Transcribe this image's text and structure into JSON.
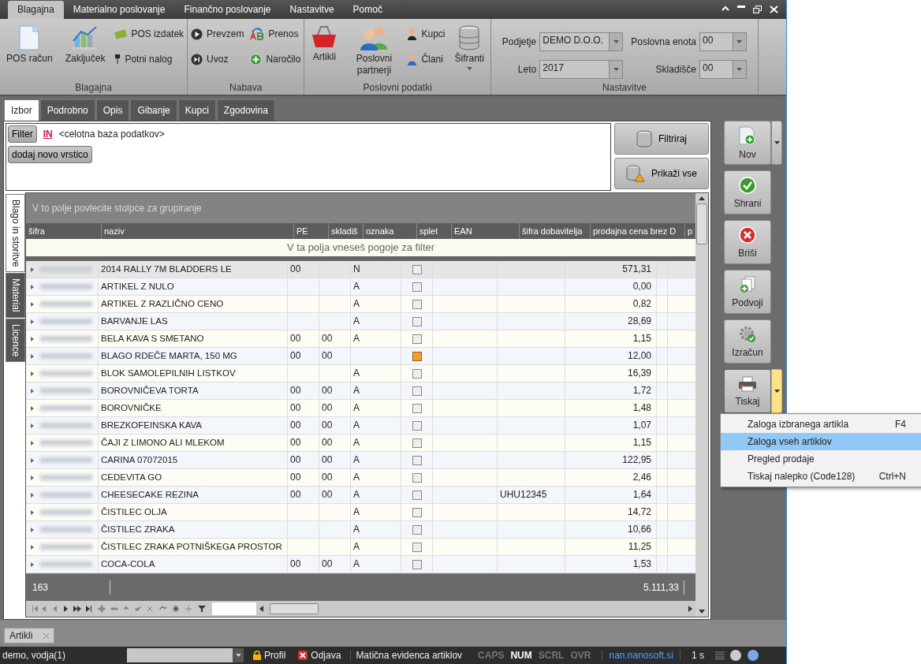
{
  "ribbon_tabs": [
    {
      "label": "Blagajna",
      "selected": true
    },
    {
      "label": "Materialno poslovanje",
      "selected": false
    },
    {
      "label": "Finančno poslovanje",
      "selected": false
    },
    {
      "label": "Nastavitve",
      "selected": false
    },
    {
      "label": "Pomoč",
      "selected": false
    }
  ],
  "ribbon_groups": [
    {
      "title": "Blagajna",
      "items": [
        {
          "label": "POS račun",
          "kind": "large"
        },
        {
          "label": "Zaključek",
          "kind": "large"
        },
        {
          "label": "POS izdatek",
          "kind": "small"
        },
        {
          "label": "Potni nalog",
          "kind": "small"
        }
      ]
    },
    {
      "title": "Nabava",
      "items": [
        {
          "label": "Prevzem",
          "kind": "small"
        },
        {
          "label": "Uvoz",
          "kind": "small"
        },
        {
          "label": "Prenos",
          "kind": "small"
        },
        {
          "label": "Naročilo",
          "kind": "small"
        }
      ]
    },
    {
      "title": "Poslovni podatki",
      "items": [
        {
          "label": "Artikli",
          "kind": "large"
        },
        {
          "label": "Poslovni partnerji",
          "kind": "large"
        },
        {
          "label": "Kupci",
          "kind": "small"
        },
        {
          "label": "Člani",
          "kind": "small"
        },
        {
          "label": "Šifranti",
          "kind": "menu"
        }
      ]
    }
  ],
  "settings": {
    "title": "Nastavitve",
    "fields": [
      {
        "label": "Podjetje",
        "value": "DEMO D.O.O."
      },
      {
        "label": "Poslovna enota",
        "value": "00"
      },
      {
        "label": "Leto",
        "value": "2017"
      },
      {
        "label": "Skladišče",
        "value": "00"
      }
    ]
  },
  "doc_tabs": [
    {
      "label": "Izbor",
      "selected": true
    },
    {
      "label": "Podrobno",
      "selected": false
    },
    {
      "label": "Opis",
      "selected": false
    },
    {
      "label": "Gibanje",
      "selected": false
    },
    {
      "label": "Kupci",
      "selected": false
    },
    {
      "label": "Zgodovina",
      "selected": false
    }
  ],
  "filter": {
    "button": "Filter",
    "operator": "IN",
    "condition": "<celotna baza podatkov>",
    "add_button": "dodaj novo vrstico"
  },
  "filter_actions": [
    {
      "label": "Filtriraj"
    },
    {
      "label": "Prikaži vse"
    }
  ],
  "side_tabs": [
    {
      "label": "Blago in storitve",
      "selected": true
    },
    {
      "label": "Material",
      "selected": false
    },
    {
      "label": "Licence",
      "selected": false
    }
  ],
  "grid": {
    "group_hint": "V to polje povlecite stolpce za grupiranje",
    "columns": [
      "šifra",
      "naziv",
      "PE",
      "skladiš",
      "oznaka",
      "splet",
      "EAN",
      "šifra dobavitelja",
      "prodajna cena brez D",
      "p"
    ],
    "filter_hint": "V ta polja vneseš pogoje za filter",
    "rows": [
      {
        "naziv": "2014 RALLY 7M BLADDERS LE",
        "pe": "00",
        "skladisce": "",
        "oznaka": "N",
        "splet": false,
        "sifra_dobavitelja": "",
        "cena": "571,31",
        "selected": true
      },
      {
        "naziv": "ARTIKEL Z NULO",
        "pe": "",
        "skladisce": "",
        "oznaka": "A",
        "splet": false,
        "sifra_dobavitelja": "",
        "cena": "0,00",
        "selected": false
      },
      {
        "naziv": "ARTIKEL Z RAZLIČNO CENO",
        "pe": "",
        "skladisce": "",
        "oznaka": "A",
        "splet": false,
        "sifra_dobavitelja": "",
        "cena": "0,82",
        "selected": false
      },
      {
        "naziv": "BARVANJE LAS",
        "pe": "",
        "skladisce": "",
        "oznaka": "A",
        "splet": false,
        "sifra_dobavitelja": "",
        "cena": "28,69",
        "selected": false
      },
      {
        "naziv": "BELA KAVA S SMETANO",
        "pe": "00",
        "skladisce": "00",
        "oznaka": "A",
        "splet": false,
        "sifra_dobavitelja": "",
        "cena": "1,15",
        "selected": false
      },
      {
        "naziv": "BLAGO RDEČE MARTA, 150 MG",
        "pe": "00",
        "skladisce": "00",
        "oznaka": "",
        "splet": true,
        "sifra_dobavitelja": "",
        "cena": "12,00",
        "selected": false
      },
      {
        "naziv": "BLOK SAMOLEPILNIH LISTKOV",
        "pe": "",
        "skladisce": "",
        "oznaka": "A",
        "splet": false,
        "sifra_dobavitelja": "",
        "cena": "16,39",
        "selected": false
      },
      {
        "naziv": "BOROVNIČEVA TORTA",
        "pe": "00",
        "skladisce": "00",
        "oznaka": "A",
        "splet": false,
        "sifra_dobavitelja": "",
        "cena": "1,72",
        "selected": false
      },
      {
        "naziv": "BOROVNIČKE",
        "pe": "00",
        "skladisce": "00",
        "oznaka": "A",
        "splet": false,
        "sifra_dobavitelja": "",
        "cena": "1,48",
        "selected": false
      },
      {
        "naziv": "BREZKOFEINSKA KAVA",
        "pe": "00",
        "skladisce": "00",
        "oznaka": "A",
        "splet": false,
        "sifra_dobavitelja": "",
        "cena": "1,07",
        "selected": false
      },
      {
        "naziv": "ČAJI Z LIMONO ALI MLEKOM",
        "pe": "00",
        "skladisce": "00",
        "oznaka": "A",
        "splet": false,
        "sifra_dobavitelja": "",
        "cena": "1,15",
        "selected": false
      },
      {
        "naziv": "CARINA 07072015",
        "pe": "00",
        "skladisce": "00",
        "oznaka": "A",
        "splet": false,
        "sifra_dobavitelja": "",
        "cena": "122,95",
        "selected": false
      },
      {
        "naziv": "CEDEVITA GO",
        "pe": "00",
        "skladisce": "00",
        "oznaka": "A",
        "splet": false,
        "sifra_dobavitelja": "",
        "cena": "2,46",
        "selected": false
      },
      {
        "naziv": "CHEESECAKE REZINA",
        "pe": "00",
        "skladisce": "00",
        "oznaka": "A",
        "splet": false,
        "sifra_dobavitelja": "UHU12345",
        "cena": "1,64",
        "selected": false
      },
      {
        "naziv": "ČISTILEC OLJA",
        "pe": "",
        "skladisce": "",
        "oznaka": "A",
        "splet": false,
        "sifra_dobavitelja": "",
        "cena": "14,72",
        "selected": false
      },
      {
        "naziv": "ČISTILEC ZRAKA",
        "pe": "",
        "skladisce": "",
        "oznaka": "A",
        "splet": false,
        "sifra_dobavitelja": "",
        "cena": "10,66",
        "selected": false
      },
      {
        "naziv": "ČISTILEC ZRAKA POTNIŠKEGA PROSTOR",
        "pe": "",
        "skladisce": "",
        "oznaka": "A",
        "splet": false,
        "sifra_dobavitelja": "",
        "cena": "11,25",
        "selected": false
      },
      {
        "naziv": "COCA-COLA",
        "pe": "00",
        "skladisce": "00",
        "oznaka": "A",
        "splet": false,
        "sifra_dobavitelja": "",
        "cena": "1,53",
        "selected": false
      }
    ],
    "footer": {
      "count": "163",
      "total": "5.111,33"
    }
  },
  "actions": [
    {
      "label": "Nov",
      "kind": "split",
      "active": false
    },
    {
      "label": "Shrani",
      "kind": "plain",
      "active": false
    },
    {
      "label": "Briši",
      "kind": "plain",
      "active": false
    },
    {
      "label": "Podvoji",
      "kind": "plain",
      "active": false
    },
    {
      "label": "Izračun",
      "kind": "plain",
      "active": false
    },
    {
      "label": "Tiskaj",
      "kind": "split",
      "active": true
    }
  ],
  "print_menu": [
    {
      "label": "Zaloga izbranega artikla",
      "shortcut": "F4",
      "selected": false
    },
    {
      "label": "Zaloga vseh artiklov",
      "selected": true
    },
    {
      "label": "Pregled prodaje",
      "selected": false
    },
    {
      "label": "Tiskaj nalepko (Code128)",
      "shortcut": "Ctrl+N",
      "selected": false
    }
  ],
  "open_windows": [
    {
      "label": "Artikli"
    }
  ],
  "status_bar": {
    "user": "demo, vodja(1)",
    "profile": "Profil",
    "logout": "Odjava",
    "module": "Matična evidenca artiklov",
    "indicators": [
      {
        "label": "CAPS",
        "on": false
      },
      {
        "label": "NUM",
        "on": true
      },
      {
        "label": "SCRL",
        "on": false
      },
      {
        "label": "OVR",
        "on": false
      }
    ],
    "server": "nan.nanosoft.si",
    "time": "1 s"
  }
}
